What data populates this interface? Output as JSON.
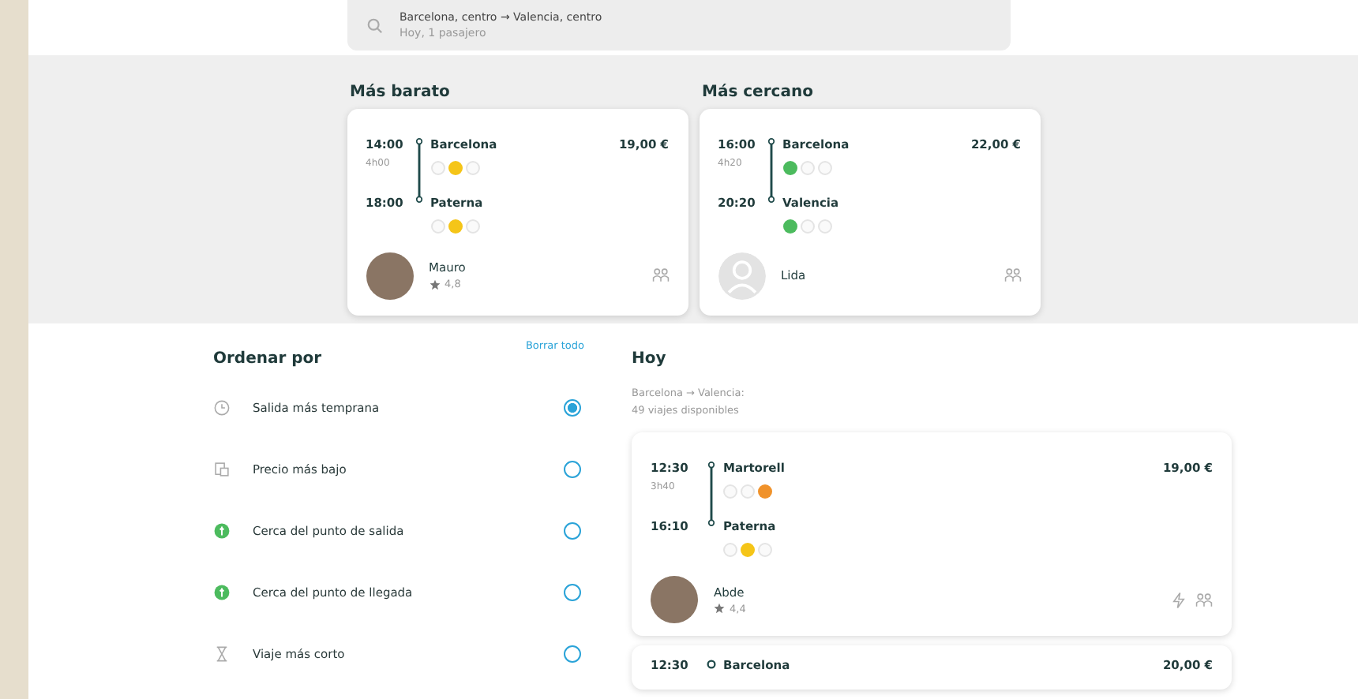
{
  "search": {
    "route": "Barcelona, centro → Valencia, centro",
    "details": "Hoy, 1 pasajero"
  },
  "highlights": [
    {
      "title": "Más barato",
      "trip": {
        "depart_time": "14:00",
        "duration": "4h00",
        "arrive_time": "18:00",
        "price": "19,00 €",
        "stops": [
          {
            "name": "Barcelona",
            "dots": [
              {
                "on": false
              },
              {
                "on": true,
                "color": "#f5c518"
              },
              {
                "on": false
              }
            ]
          },
          {
            "name": "Paterna",
            "dots": [
              {
                "on": false
              },
              {
                "on": true,
                "color": "#f5c518"
              },
              {
                "on": false
              }
            ]
          }
        ],
        "driver": {
          "name": "Mauro",
          "rating": "4,8",
          "kind": "photo"
        },
        "features": [
          {
            "kind": "seats"
          }
        ]
      }
    },
    {
      "title": "Más cercano",
      "trip": {
        "depart_time": "16:00",
        "duration": "4h20",
        "arrive_time": "20:20",
        "price": "22,00 €",
        "stops": [
          {
            "name": "Barcelona",
            "dots": [
              {
                "on": true,
                "color": "#4cbb5e"
              },
              {
                "on": false
              },
              {
                "on": false
              }
            ]
          },
          {
            "name": "Valencia",
            "dots": [
              {
                "on": true,
                "color": "#4cbb5e"
              },
              {
                "on": false
              },
              {
                "on": false
              }
            ]
          }
        ],
        "driver": {
          "name": "Lida",
          "kind": "default"
        },
        "features": [
          {
            "kind": "seats"
          }
        ]
      }
    }
  ],
  "sort": {
    "title": "Ordenar por",
    "clear": "Borrar todo",
    "options": [
      {
        "label": "Salida más temprana",
        "kind": "clock",
        "selected": true
      },
      {
        "label": "Precio más bajo",
        "kind": "price",
        "selected": false
      },
      {
        "label": "Cerca del punto de salida",
        "kind": "pin",
        "selected": false
      },
      {
        "label": "Cerca del punto de llegada",
        "kind": "pin",
        "selected": false
      },
      {
        "label": "Viaje más corto",
        "kind": "hourglass",
        "selected": false
      }
    ]
  },
  "results": {
    "title": "Hoy",
    "summary_route": "Barcelona → Valencia:",
    "summary_count": "49 viajes disponibles",
    "trips": [
      {
        "depart_time": "12:30",
        "duration": "3h40",
        "arrive_time": "16:10",
        "price": "19,00 €",
        "stops": [
          {
            "name": "Martorell",
            "dots": [
              {
                "on": false
              },
              {
                "on": false
              },
              {
                "on": true,
                "color": "#f0922a"
              }
            ]
          },
          {
            "name": "Paterna",
            "dots": [
              {
                "on": false
              },
              {
                "on": true,
                "color": "#f5c518"
              },
              {
                "on": false
              }
            ]
          }
        ],
        "driver": {
          "name": "Abde",
          "rating": "4,4",
          "kind": "photo"
        },
        "features": [
          {
            "kind": "instant"
          },
          {
            "kind": "seats"
          }
        ]
      },
      {
        "depart_time": "12:30",
        "price": "20,00 €",
        "stops": [
          {
            "name": "Barcelona"
          }
        ]
      }
    ]
  }
}
